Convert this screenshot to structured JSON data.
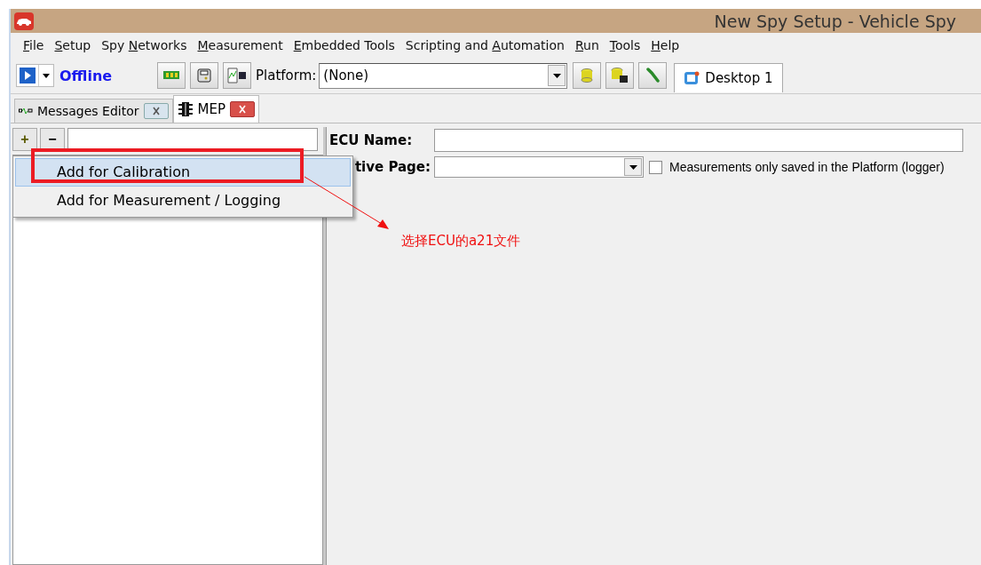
{
  "window": {
    "title": "New Spy Setup - Vehicle Spy"
  },
  "menu": [
    {
      "key": "F",
      "post": "ile"
    },
    {
      "key": "S",
      "post": "etup"
    },
    {
      "pre": "Spy ",
      "key": "N",
      "post": "etworks"
    },
    {
      "key": "M",
      "post": "easurement"
    },
    {
      "key": "E",
      "post": "mbedded Tools"
    },
    {
      "pre": "Scripting and ",
      "key": "A",
      "post": "utomation"
    },
    {
      "key": "R",
      "post": "un"
    },
    {
      "key": "T",
      "post": "ools"
    },
    {
      "key": "H",
      "post": "elp"
    }
  ],
  "toolbar": {
    "status": "Offline",
    "platform_label": "Platform:",
    "platform_value": "(None)",
    "desktop_tab": "Desktop 1"
  },
  "tabs": [
    {
      "label": "Messages Editor",
      "selected": false
    },
    {
      "label": "MEP",
      "selected": true
    }
  ],
  "left_panel": {
    "add": "+",
    "remove": "−"
  },
  "popup_menu": [
    {
      "label": "Add for Calibration",
      "selected": true
    },
    {
      "label": "Add for Measurement / Logging",
      "selected": false
    }
  ],
  "form": {
    "ecu_name_label": "ECU Name:",
    "active_page_label": "tive Page:",
    "checkbox": {
      "label": "Measurements only saved in the Platform (logger)",
      "checked": false
    }
  },
  "annotation": {
    "text": "选择ECU的a21文件"
  }
}
